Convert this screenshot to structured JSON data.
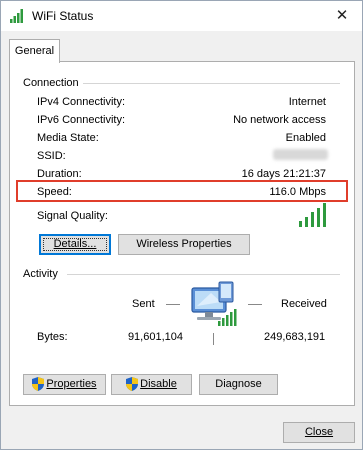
{
  "window": {
    "title": "WiFi Status",
    "close_glyph": "✕"
  },
  "tabs": [
    {
      "label": "General"
    }
  ],
  "connection": {
    "heading": "Connection",
    "rows": [
      {
        "label": "IPv4 Connectivity:",
        "value": "Internet"
      },
      {
        "label": "IPv6 Connectivity:",
        "value": "No network access"
      },
      {
        "label": "Media State:",
        "value": "Enabled"
      },
      {
        "label": "SSID:",
        "value": ""
      },
      {
        "label": "Duration:",
        "value": "16 days 21:21:37"
      },
      {
        "label": "Speed:",
        "value": "116.0 Mbps"
      }
    ],
    "signal_label": "Signal Quality:",
    "signal_bars_lit": 5,
    "signal_bars_total": 5,
    "highlight_color": "#e03d2b"
  },
  "buttons": {
    "details": "Details...",
    "wireless_properties": "Wireless Properties",
    "properties": "Properties",
    "disable": "Disable",
    "diagnose": "Diagnose",
    "close": "Close"
  },
  "activity": {
    "heading": "Activity",
    "sent_label": "Sent",
    "received_label": "Received",
    "bytes_label": "Bytes:",
    "bytes_sent": "91,601,104",
    "bytes_received": "249,683,191"
  },
  "icons": {
    "title": "wifi-signal-icon",
    "network": "network-computer-icon",
    "shield": "uac-shield-icon"
  },
  "colors": {
    "signal": "#2e9a3e",
    "accent": "#0078d7"
  }
}
